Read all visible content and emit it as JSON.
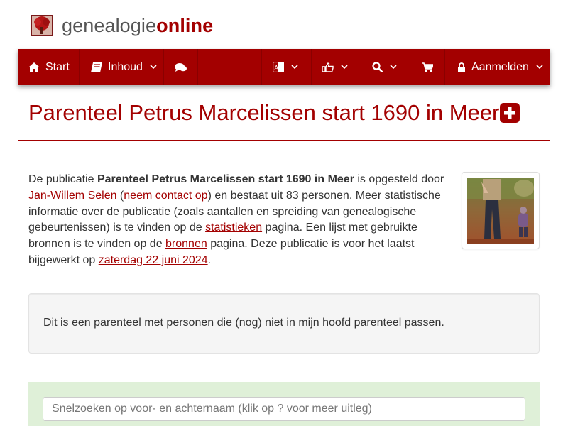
{
  "site": {
    "name_part1": "genealogie",
    "name_part2": "online",
    "brand_color": "#a30000"
  },
  "nav": {
    "start_label": "Start",
    "inhoud_label": "Inhoud",
    "login_label": "Aanmelden",
    "icons": [
      "home-icon",
      "book-icon",
      "comments-icon",
      "language-icon",
      "share-icon",
      "search-icon",
      "cart-icon",
      "lock-icon"
    ]
  },
  "page": {
    "title": "Parenteel Petrus Marcelissen start 1690 in Meer"
  },
  "intro": {
    "t1": "De publicatie ",
    "pub_name": "Parenteel Petrus Marcelissen start 1690 in Meer",
    "t2": " is opgesteld door ",
    "author": "Jan-Willem Selen",
    "t3": " (",
    "contact": "neem contact op",
    "t4": ") en bestaat uit 83 personen. Meer statistische informatie over de publicatie (zoals aantallen en spreiding van genealogische gebeurtenissen) is te vinden op de ",
    "stats": "statistieken",
    "t5": " pagina. Een lijst met gebruikte bronnen is te vinden op de ",
    "sources": "bronnen",
    "t6": " pagina. Deze publicatie is voor het laatst bijgewerkt op ",
    "date": "zaterdag 22 juni 2024",
    "t7": "."
  },
  "note": {
    "text": "Dit is een parenteel met personen die (nog) niet in mijn hoofd parenteel passen."
  },
  "search": {
    "placeholder": "Snelzoeken op voor- en achternaam (klik op ? voor meer uitleg)"
  }
}
